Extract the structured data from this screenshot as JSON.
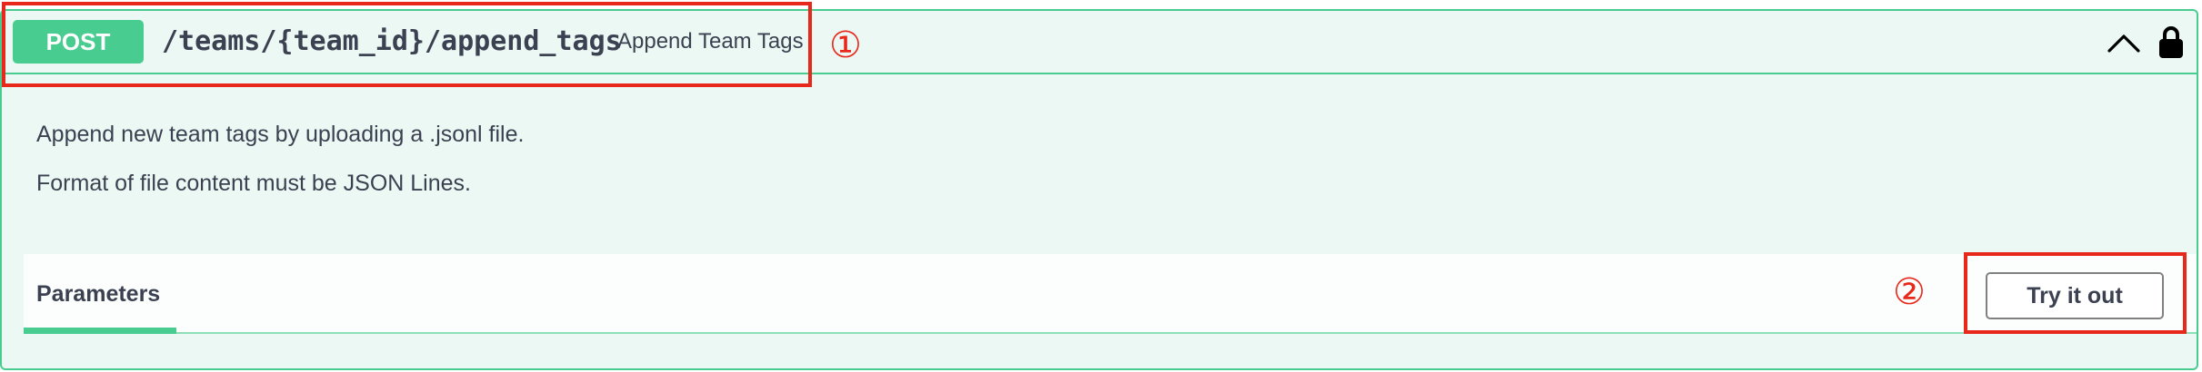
{
  "operation": {
    "method": "POST",
    "path": "/teams/{team_id}/append_tags",
    "summary": "Append Team Tags",
    "description_lines": [
      "Append new team tags by uploading a .jsonl file.",
      "Format of file content must be JSON Lines."
    ]
  },
  "controls": {
    "collapse_icon": "chevron-up-icon",
    "lock_icon": "lock-icon"
  },
  "parameters": {
    "tab_label": "Parameters",
    "try_button_label": "Try it out"
  },
  "annotations": {
    "marker_1": "①",
    "marker_2": "②"
  },
  "colors": {
    "method_post": "#49cc90",
    "block_background": "#ecf8f3",
    "text_primary": "#3b4151",
    "annotation_red": "#e8281b"
  }
}
